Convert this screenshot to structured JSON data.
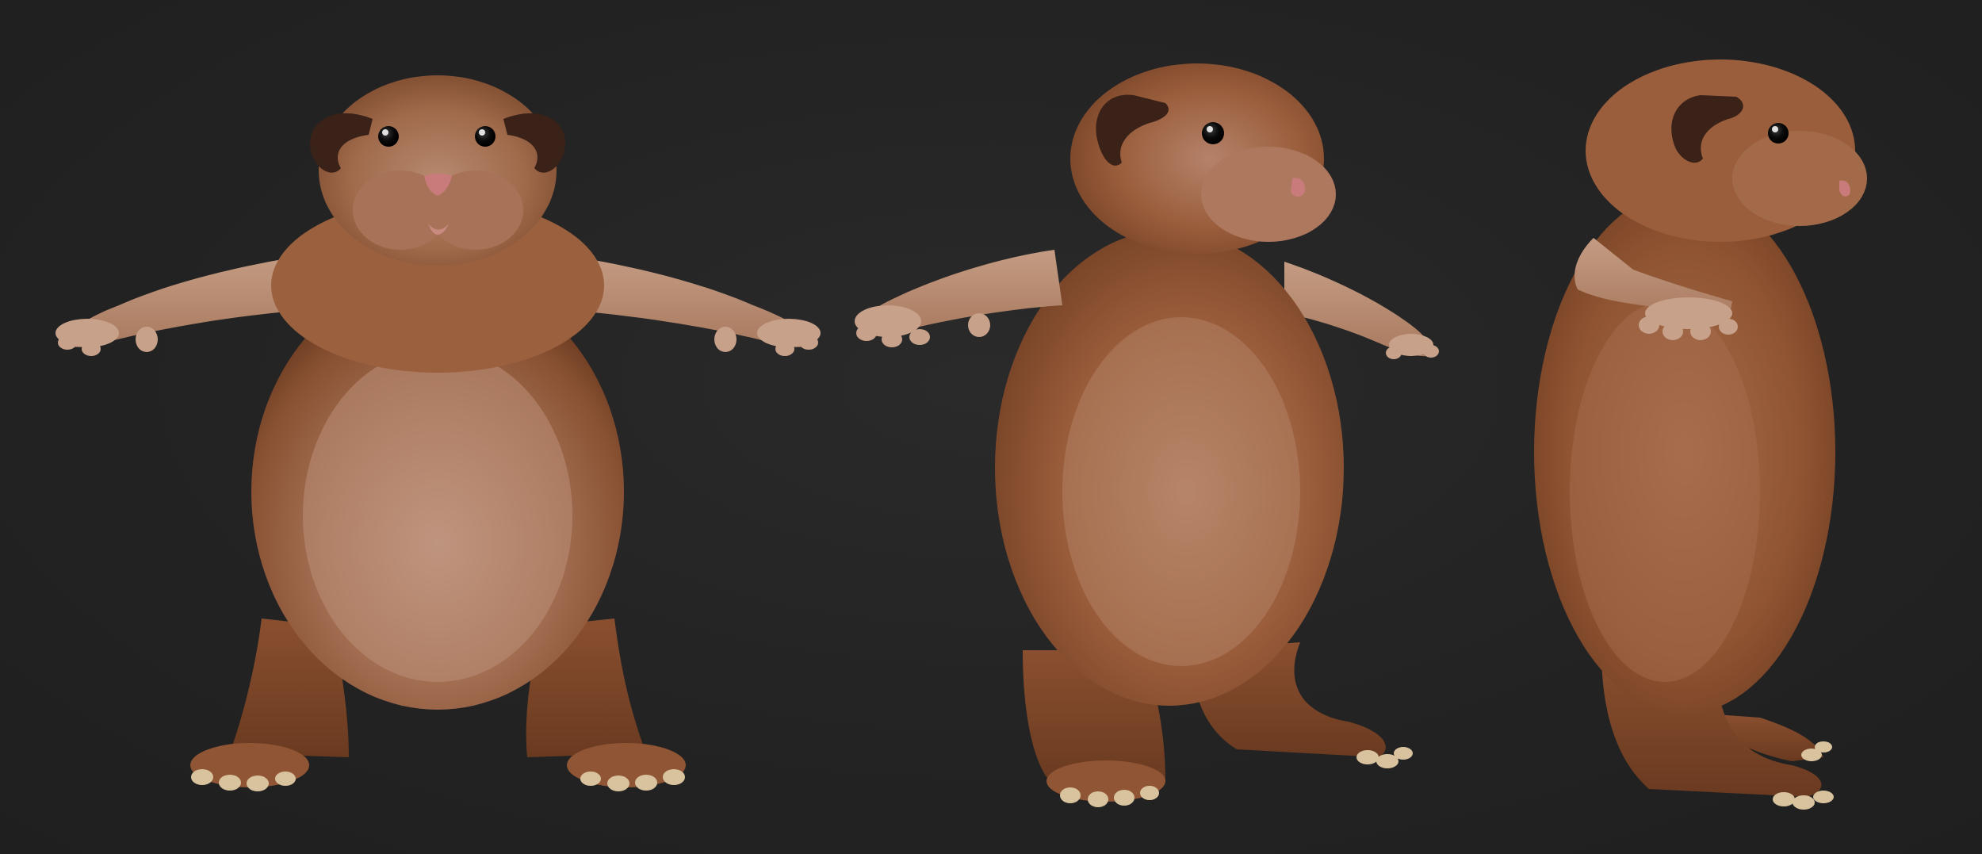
{
  "scene": {
    "background_color": "#232323",
    "views": [
      {
        "name": "front-view"
      },
      {
        "name": "three-quarter-view"
      },
      {
        "name": "side-view"
      }
    ]
  },
  "colors": {
    "fur_dark": "#7a4628",
    "fur_mid": "#9c5e3a",
    "fur_light": "#b88365",
    "belly": "#b98a72",
    "paws": "#c39a7f",
    "ear": "#3a2218",
    "eye": "#0a0a0a",
    "nose": "#c97a7a",
    "claws": "#d9c39e"
  }
}
